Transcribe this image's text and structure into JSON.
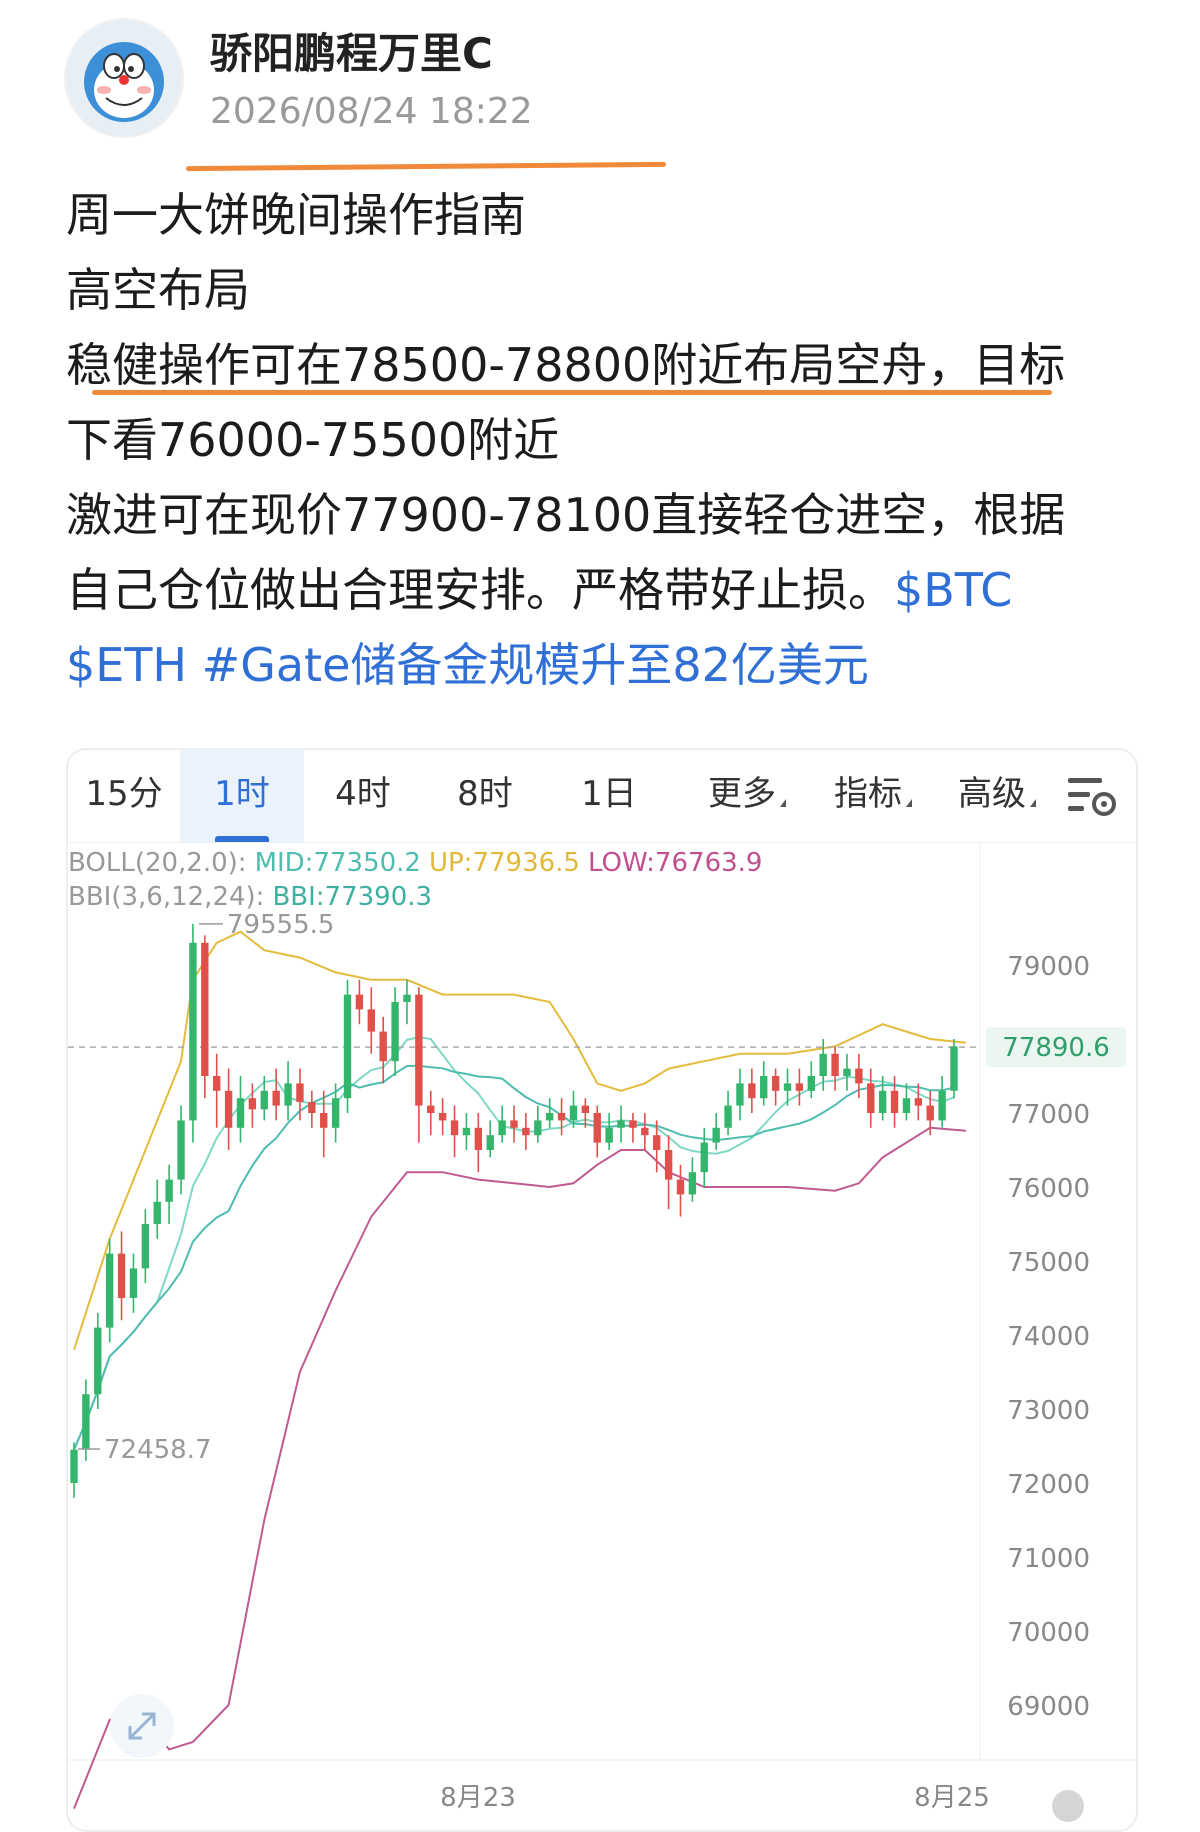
{
  "post": {
    "author": "骄阳鹏程万里C",
    "timestamp": "2026/08/24 18:22",
    "lines": [
      "周一大饼晚间操作指南",
      "高空布局",
      "稳健操作可在78500-78800附近布局空舟，目标",
      "下看76000-75500附近",
      "激进可在现价77900-78100直接轻仓进空，根据",
      "自己仓位做出合理安排。严格带好止损。"
    ],
    "tag_btc": "$BTC",
    "tag_eth": "$ETH",
    "tag_gate": "#Gate储备金规模升至82亿美元",
    "accent_color": "#2f6fd6",
    "highlight_color": "#f08a3a"
  },
  "chart": {
    "tabs": [
      {
        "label": "15分",
        "active": false
      },
      {
        "label": "1时",
        "active": true
      },
      {
        "label": "4时",
        "active": false
      },
      {
        "label": "8时",
        "active": false
      },
      {
        "label": "1日",
        "active": false
      },
      {
        "label": "更多",
        "active": false
      },
      {
        "label": "指标",
        "active": false
      },
      {
        "label": "高级",
        "active": false
      }
    ],
    "settings_icon": "chart-settings-icon",
    "boll": {
      "prefix": "BOLL(20,2.0):",
      "mid": "MID:77350.2",
      "up": "UP:77936.5",
      "low": "LOW:76763.9"
    },
    "bbi": {
      "prefix": "BBI(3,6,12,24):",
      "value": "BBI:77390.3"
    },
    "high_label": "79555.5",
    "low_label": "72458.7",
    "current_price": "77890.6",
    "x_labels": [
      "8月23",
      "8月25"
    ]
  },
  "chart_data": {
    "type": "candlestick",
    "ylim": [
      68500,
      80600
    ],
    "y_ticks": [
      79000,
      77000,
      76000,
      75000,
      74000,
      73000,
      72000,
      71000,
      70000,
      69000
    ],
    "current_price": 77890.6,
    "high": 79555.5,
    "low": 72458.7,
    "candles": [
      [
        72000,
        72450,
        71800,
        72550
      ],
      [
        72450,
        73200,
        72300,
        73400
      ],
      [
        73200,
        74100,
        73000,
        74300
      ],
      [
        74100,
        75100,
        73900,
        75300
      ],
      [
        75100,
        74500,
        74200,
        75400
      ],
      [
        74500,
        74900,
        74300,
        75100
      ],
      [
        74900,
        75500,
        74700,
        75700
      ],
      [
        75500,
        75800,
        75300,
        76100
      ],
      [
        75800,
        76100,
        75500,
        76300
      ],
      [
        76100,
        76900,
        75900,
        77100
      ],
      [
        76900,
        79300,
        76600,
        79555
      ],
      [
        79300,
        77500,
        77200,
        79400
      ],
      [
        77500,
        77300,
        76800,
        77800
      ],
      [
        77300,
        76800,
        76500,
        77600
      ],
      [
        76800,
        77200,
        76600,
        77500
      ],
      [
        77200,
        77050,
        76800,
        77400
      ],
      [
        77050,
        77300,
        76900,
        77500
      ],
      [
        77300,
        77100,
        76900,
        77600
      ],
      [
        77100,
        77400,
        76900,
        77700
      ],
      [
        77400,
        77150,
        76900,
        77600
      ],
      [
        77150,
        77000,
        76800,
        77300
      ],
      [
        77000,
        76800,
        76400,
        77300
      ],
      [
        76800,
        77200,
        76600,
        77400
      ],
      [
        77200,
        78600,
        77000,
        78800
      ],
      [
        78600,
        78400,
        78200,
        78800
      ],
      [
        78400,
        78100,
        77800,
        78700
      ],
      [
        78100,
        77700,
        77400,
        78300
      ],
      [
        77700,
        78500,
        77500,
        78700
      ],
      [
        78500,
        78600,
        78200,
        78800
      ],
      [
        78600,
        77100,
        76600,
        78700
      ],
      [
        77100,
        77000,
        76700,
        77300
      ],
      [
        77000,
        76900,
        76700,
        77200
      ],
      [
        76900,
        76700,
        76400,
        77100
      ],
      [
        76700,
        76800,
        76500,
        77000
      ],
      [
        76800,
        76500,
        76200,
        77000
      ],
      [
        76500,
        76700,
        76400,
        76900
      ],
      [
        76700,
        76900,
        76600,
        77100
      ],
      [
        76900,
        76800,
        76600,
        77100
      ],
      [
        76800,
        76700,
        76500,
        77000
      ],
      [
        76700,
        76900,
        76600,
        77100
      ],
      [
        76900,
        77000,
        76800,
        77200
      ],
      [
        77000,
        76900,
        76700,
        77200
      ],
      [
        76900,
        77100,
        76800,
        77300
      ],
      [
        77100,
        77000,
        76800,
        77200
      ],
      [
        77000,
        76600,
        76400,
        77100
      ],
      [
        76600,
        76800,
        76500,
        77000
      ],
      [
        76800,
        76900,
        76600,
        77100
      ],
      [
        76900,
        76800,
        76600,
        77000
      ],
      [
        76800,
        76700,
        76500,
        77000
      ],
      [
        76700,
        76500,
        76200,
        76900
      ],
      [
        76500,
        76100,
        75700,
        76700
      ],
      [
        76100,
        75900,
        75600,
        76300
      ],
      [
        75900,
        76200,
        75800,
        76400
      ],
      [
        76200,
        76600,
        76000,
        76800
      ],
      [
        76600,
        76800,
        76500,
        77000
      ],
      [
        76800,
        77100,
        76700,
        77300
      ],
      [
        77100,
        77400,
        76900,
        77600
      ],
      [
        77400,
        77200,
        77000,
        77600
      ],
      [
        77200,
        77500,
        77100,
        77700
      ],
      [
        77500,
        77300,
        77100,
        77600
      ],
      [
        77300,
        77400,
        77100,
        77600
      ],
      [
        77400,
        77300,
        77100,
        77600
      ],
      [
        77300,
        77500,
        77200,
        77700
      ],
      [
        77500,
        77800,
        77300,
        78000
      ],
      [
        77800,
        77500,
        77300,
        77900
      ],
      [
        77500,
        77600,
        77300,
        77800
      ],
      [
        77600,
        77400,
        77200,
        77800
      ],
      [
        77400,
        77000,
        76800,
        77600
      ],
      [
        77000,
        77300,
        76900,
        77500
      ],
      [
        77300,
        77000,
        76800,
        77500
      ],
      [
        77000,
        77200,
        76900,
        77400
      ],
      [
        77200,
        77100,
        76900,
        77400
      ],
      [
        77100,
        76900,
        76700,
        77300
      ],
      [
        76900,
        77300,
        76800,
        77500
      ],
      [
        77300,
        77900,
        77200,
        78000
      ]
    ],
    "bands": {
      "upper": [
        [
          0,
          73800
        ],
        [
          3,
          75300
        ],
        [
          6,
          76500
        ],
        [
          9,
          77700
        ],
        [
          10,
          78800
        ],
        [
          12,
          79300
        ],
        [
          14,
          79450
        ],
        [
          16,
          79200
        ],
        [
          19,
          79100
        ],
        [
          22,
          78900
        ],
        [
          25,
          78800
        ],
        [
          28,
          78800
        ],
        [
          31,
          78600
        ],
        [
          34,
          78600
        ],
        [
          37,
          78600
        ],
        [
          40,
          78500
        ],
        [
          42,
          78000
        ],
        [
          44,
          77400
        ],
        [
          46,
          77300
        ],
        [
          48,
          77400
        ],
        [
          50,
          77600
        ],
        [
          53,
          77700
        ],
        [
          56,
          77800
        ],
        [
          60,
          77800
        ],
        [
          64,
          77900
        ],
        [
          68,
          78200
        ],
        [
          72,
          78000
        ],
        [
          75,
          77950
        ]
      ],
      "lower": [
        [
          0,
          67600
        ],
        [
          3,
          68800
        ],
        [
          6,
          68800
        ],
        [
          8,
          68400
        ],
        [
          10,
          68500
        ],
        [
          13,
          69000
        ],
        [
          16,
          71500
        ],
        [
          19,
          73500
        ],
        [
          22,
          74600
        ],
        [
          25,
          75600
        ],
        [
          28,
          76200
        ],
        [
          31,
          76200
        ],
        [
          34,
          76100
        ],
        [
          37,
          76050
        ],
        [
          40,
          76000
        ],
        [
          42,
          76050
        ],
        [
          44,
          76300
        ],
        [
          46,
          76500
        ],
        [
          48,
          76500
        ],
        [
          50,
          76200
        ],
        [
          53,
          76000
        ],
        [
          56,
          76000
        ],
        [
          60,
          76000
        ],
        [
          64,
          75950
        ],
        [
          66,
          76050
        ],
        [
          68,
          76400
        ],
        [
          72,
          76800
        ],
        [
          75,
          76760
        ]
      ]
    }
  }
}
